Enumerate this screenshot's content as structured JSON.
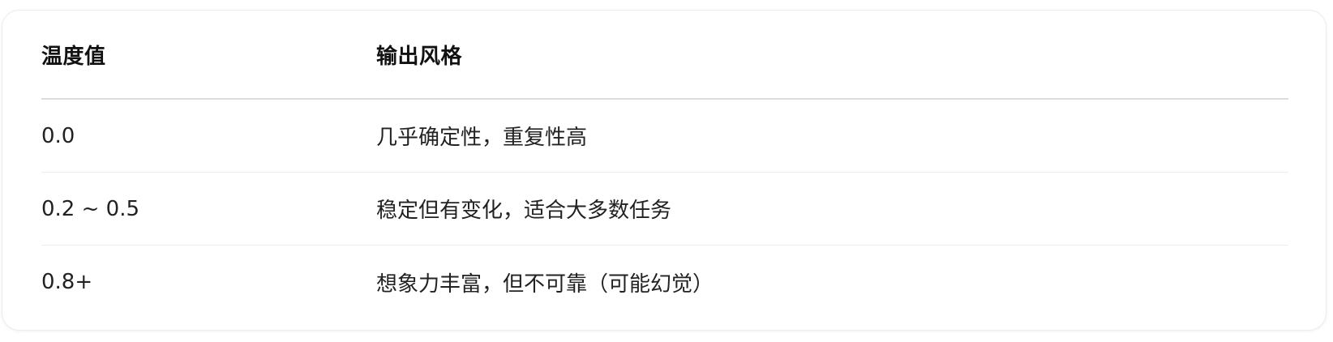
{
  "table": {
    "headers": [
      "温度值",
      "输出风格"
    ],
    "rows": [
      [
        "0.0",
        "几乎确定性，重复性高"
      ],
      [
        "0.2 ~ 0.5",
        "稳定但有变化，适合大多数任务"
      ],
      [
        "0.8+",
        "想象力丰富，但不可靠（可能幻觉）"
      ]
    ]
  }
}
